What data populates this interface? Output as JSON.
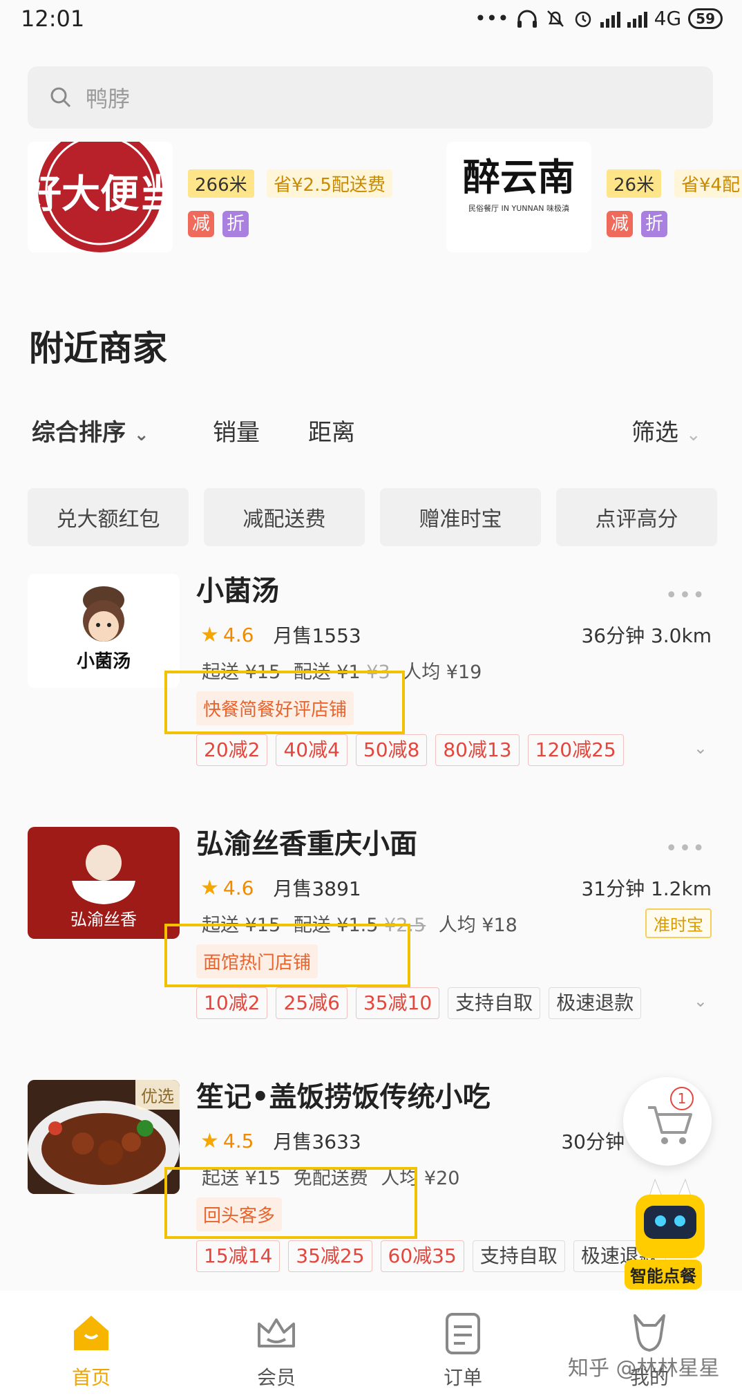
{
  "status_bar": {
    "time": "12:01",
    "dots": "•••",
    "network": "4G",
    "battery": "59"
  },
  "search": {
    "placeholder": "鸭脖"
  },
  "carousel": [
    {
      "logo_text": "好大便当",
      "distance": "266米",
      "savings": "省¥2.5配送费",
      "badges": [
        "减",
        "折"
      ]
    },
    {
      "logo_text": "醉云南",
      "logo_sub": "民俗餐厅 IN YUNNAN 味极滇",
      "distance": "26米",
      "savings": "省¥4配",
      "badges": [
        "减",
        "折"
      ]
    }
  ],
  "section_title": "附近商家",
  "sort": {
    "default": "综合排序",
    "sales": "销量",
    "distance": "距离",
    "filter": "筛选"
  },
  "chips": [
    "兑大额红包",
    "减配送费",
    "赠准时宝",
    "点评高分"
  ],
  "shops": [
    {
      "name": "小菌汤",
      "logo_text": "小菌汤",
      "rating": "4.6",
      "monthly_sales": "月售1553",
      "eta_distance": "36分钟  3.0km",
      "min_order": "起送 ¥15",
      "delivery": "配送 ¥1",
      "delivery_original": "¥3",
      "avg_price": "人均 ¥19",
      "tag": "快餐简餐好评店铺",
      "promos": [
        "20减2",
        "40减4",
        "50减8",
        "80减13",
        "120减25"
      ]
    },
    {
      "name": "弘渝丝香重庆小面",
      "logo_text": "弘渝丝香",
      "rating": "4.6",
      "monthly_sales": "月售3891",
      "eta_distance": "31分钟  1.2km",
      "min_order": "起送 ¥15",
      "delivery": "配送 ¥1.5",
      "delivery_original": "¥2.5",
      "avg_price": "人均 ¥18",
      "badge": "准时宝",
      "tag": "面馆热门店铺",
      "promos": [
        "10减2",
        "25减6",
        "35减10"
      ],
      "services": [
        "支持自取",
        "极速退款"
      ]
    },
    {
      "name": "笙记•盖饭捞饭传统小吃",
      "rating": "4.5",
      "monthly_sales": "月售3633",
      "eta_distance": "30分钟",
      "min_order": "起送 ¥15",
      "delivery": "免配送费",
      "avg_price": "人均 ¥20",
      "featured": "优选",
      "tag": "回头客多",
      "promos": [
        "15减14",
        "35减25",
        "60减35"
      ],
      "services": [
        "支持自取",
        "极速退款"
      ]
    }
  ],
  "floating": {
    "cart_count": "1",
    "assistant_label": "智能点餐"
  },
  "bottom_nav": [
    {
      "label": "首页",
      "icon": "home-icon"
    },
    {
      "label": "会员",
      "icon": "crown-icon"
    },
    {
      "label": "订单",
      "icon": "order-icon"
    },
    {
      "label": "我的",
      "icon": "profile-icon"
    }
  ],
  "watermark": "知乎 @林林星星",
  "colors": {
    "accent": "#f0a500",
    "promo_red": "#e2463c",
    "tag_orange": "#e8642e",
    "highlight": "#f2c200"
  }
}
